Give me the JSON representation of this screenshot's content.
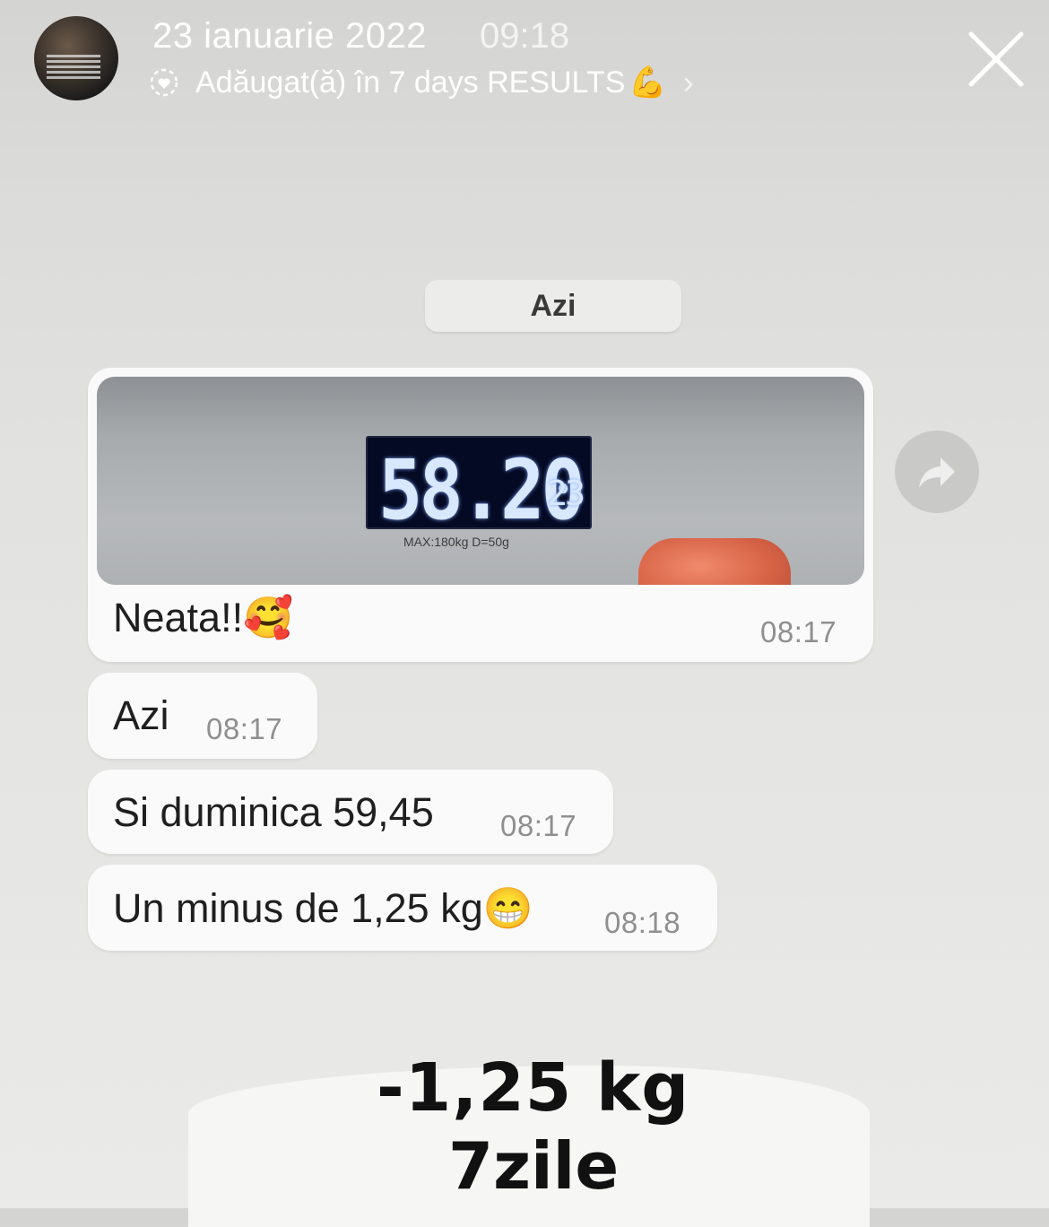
{
  "story_header": {
    "date": "23 ianuarie 2022",
    "time": "09:18",
    "added_to": "Adăugat(ă) în 7 days RESULTS",
    "added_emoji": "💪",
    "chevron": "›"
  },
  "chat": {
    "day_chip": "Azi",
    "photo_message": {
      "scale_reading": "58.20",
      "scale_temp": "23",
      "scale_spec": "MAX:180kg D=50g",
      "text": "Neata!!",
      "emoji": "🥰",
      "time": "08:17"
    },
    "messages": [
      {
        "text": "Azi",
        "emoji": "",
        "time": "08:17"
      },
      {
        "text": "Si duminica 59,45",
        "emoji": "",
        "time": "08:17"
      },
      {
        "text": "Un minus de 1,25 kg",
        "emoji": "😁",
        "time": "08:18"
      }
    ]
  },
  "caption": {
    "line1": "-1,25 kg",
    "line2": "7zile"
  },
  "icons": [
    "avatar",
    "highlight-icon",
    "chevron-right-icon",
    "close-icon",
    "forward-icon"
  ],
  "colors": {
    "header_text": "#ffffff",
    "bubble": "#fafafa",
    "timestamp": "#8f8f8f"
  }
}
